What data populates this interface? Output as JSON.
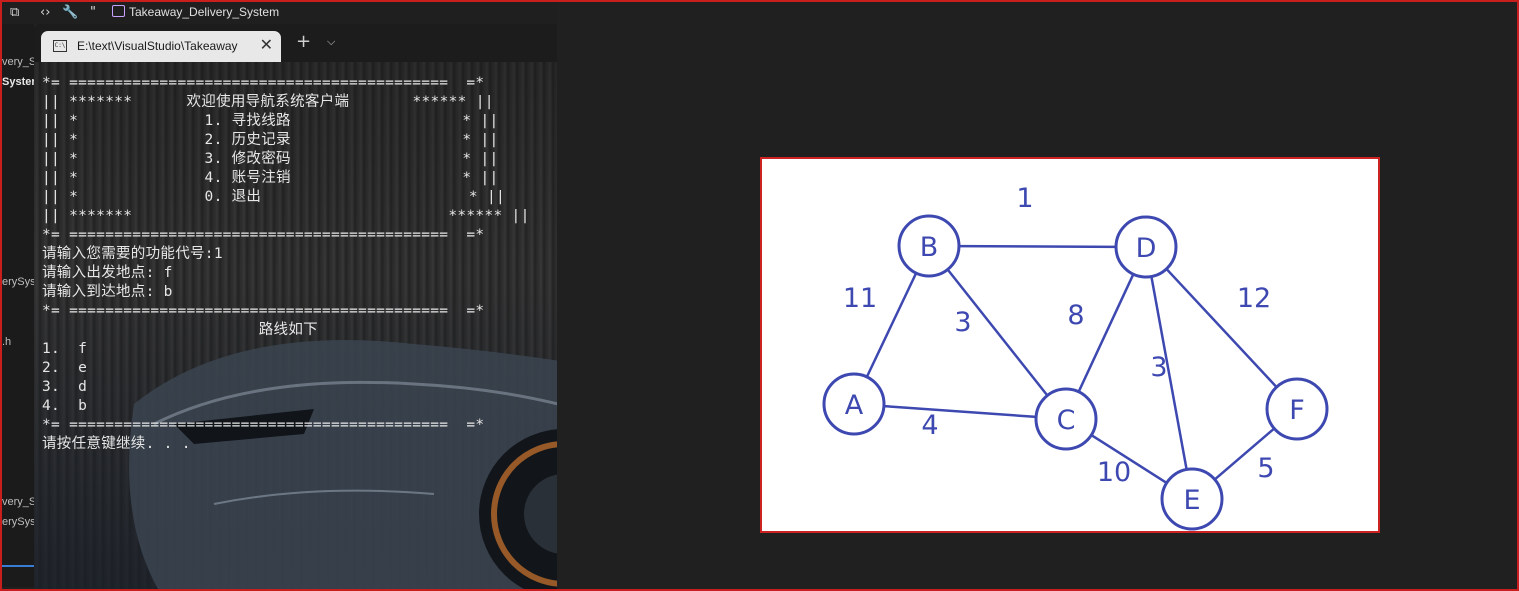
{
  "ide": {
    "window_title": "Takeaway_Delivery_System",
    "left_labels": [
      "very_S",
      "Syster",
      "erySys",
      ".h",
      "very_S",
      "erySys"
    ]
  },
  "terminal": {
    "tab_title": "E:\\text\\VisualStudio\\Takeaway",
    "lines": [
      "*= ==========================================  =*",
      "|| *******      欢迎使用导航系统客户端       ****** ||",
      "|| *              1. 寻找线路                   * ||",
      "|| *              2. 历史记录                   * ||",
      "|| *              3. 修改密码                   * ||",
      "|| *              4. 账号注销                   * ||",
      "|| *              0. 退出                       * ||",
      "|| *******                                   ****** ||",
      "*= ==========================================  =*",
      "请输入您需要的功能代号:1",
      "请输入出发地点: f",
      "请输入到达地点: b",
      "*= ==========================================  =*",
      "                        路线如下",
      "1.  f",
      "2.  e",
      "3.  d",
      "4.  b",
      "*= ==========================================  =*",
      "请按任意键继续. . ."
    ]
  },
  "graph": {
    "nodes": [
      {
        "label": "A"
      },
      {
        "label": "B"
      },
      {
        "label": "C"
      },
      {
        "label": "D"
      },
      {
        "label": "E"
      },
      {
        "label": "F"
      }
    ],
    "edges": [
      {
        "from": "B",
        "to": "D",
        "weight": "1"
      },
      {
        "from": "A",
        "to": "B",
        "weight": "11"
      },
      {
        "from": "B",
        "to": "C",
        "weight": "3"
      },
      {
        "from": "C",
        "to": "D",
        "weight": "8"
      },
      {
        "from": "D",
        "to": "F",
        "weight": "12"
      },
      {
        "from": "D",
        "to": "E",
        "weight": "3"
      },
      {
        "from": "A",
        "to": "C",
        "weight": "4"
      },
      {
        "from": "C",
        "to": "E",
        "weight": "10"
      },
      {
        "from": "E",
        "to": "F",
        "weight": "5"
      }
    ],
    "color": "#3d48b0"
  }
}
